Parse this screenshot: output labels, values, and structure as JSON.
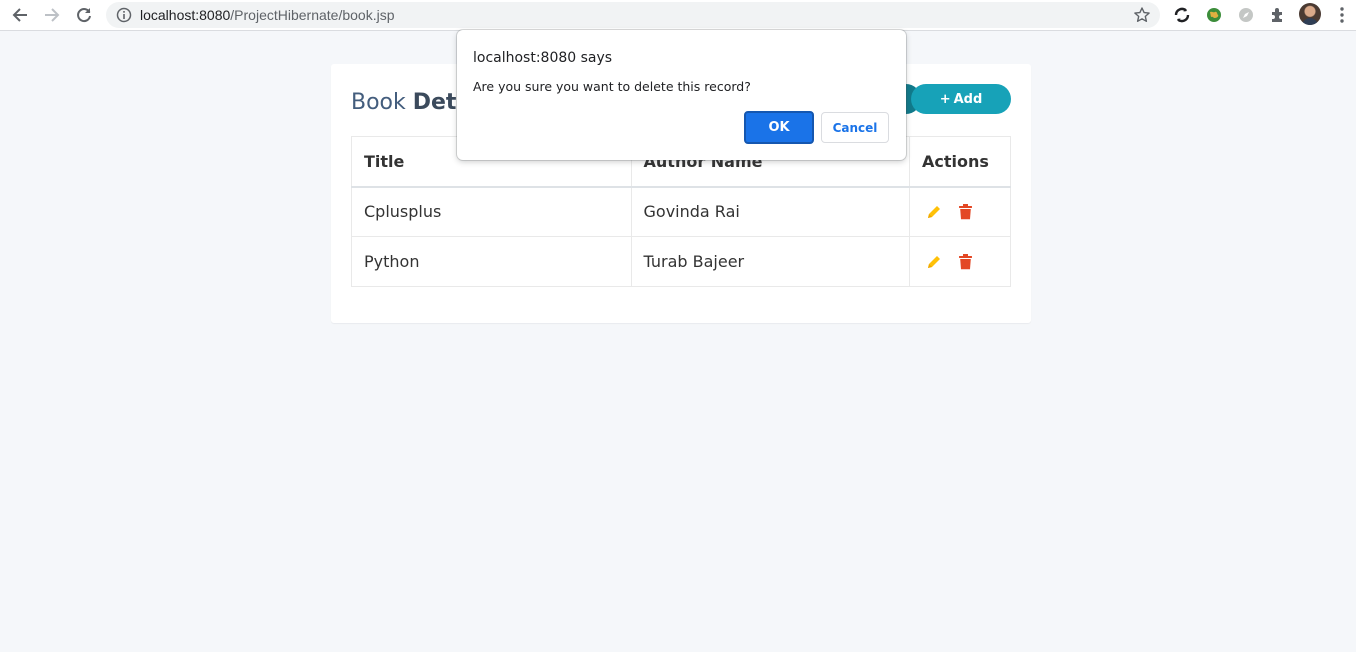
{
  "browser": {
    "url_host": "localhost:8080",
    "url_path": "/ProjectHibernate/book.jsp"
  },
  "icons": {
    "back": "arrow-left-icon",
    "forward": "arrow-right-icon",
    "reload": "reload-icon",
    "info": "info-icon",
    "bookmark": "star-icon",
    "edit": "pencil-icon",
    "delete": "trash-icon",
    "puzzle": "puzzle-icon",
    "menu": "kebab-menu-icon"
  },
  "page": {
    "title_light": "Book ",
    "title_bold": "Deta",
    "add_button": {
      "icon": "+",
      "label": "Add"
    }
  },
  "table": {
    "headers": [
      "Title",
      "Author Name",
      "Actions"
    ],
    "rows": [
      {
        "title": "Cplusplus",
        "author": "Govinda Rai"
      },
      {
        "title": "Python",
        "author": "Turab Bajeer"
      }
    ]
  },
  "dialog": {
    "title": "localhost:8080 says",
    "message": "Are you sure you want to delete this record?",
    "ok_label": "OK",
    "cancel_label": "Cancel"
  },
  "colors": {
    "add_button": "#17a2b8",
    "edit_icon": "#ffc107",
    "delete_icon": "#e34724",
    "ok_button": "#1a73e8"
  }
}
